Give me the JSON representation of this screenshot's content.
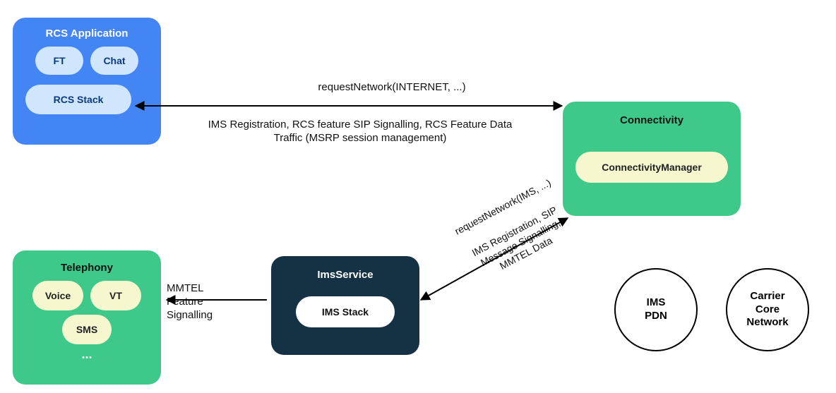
{
  "rcs_app": {
    "title": "RCS Application",
    "ft": "FT",
    "chat": "Chat",
    "stack": "RCS Stack"
  },
  "connectivity": {
    "title": "Connectivity",
    "manager": "ConnectivityManager"
  },
  "telephony": {
    "title": "Telephony",
    "voice": "Voice",
    "vt": "VT",
    "sms": "SMS",
    "more": "..."
  },
  "ims_service": {
    "title": "ImsService",
    "stack": "IMS Stack"
  },
  "circles": {
    "ims_pdn": "IMS\nPDN",
    "carrier": "Carrier\nCore\nNetwork"
  },
  "arrows": {
    "top_request": "requestNetwork(INTERNET, ...)",
    "top_detail": "IMS Registration, RCS feature SIP Signalling, RCS Feature Data\nTraffic (MSRP session management)",
    "mmtel": "MMTEL\nFeature\nSignalling",
    "diag_request": "requestNetwork(IMS, ...)",
    "diag_detail": "IMS Registration, SIP\nMessage Signalling,\nMMTEL Data"
  }
}
